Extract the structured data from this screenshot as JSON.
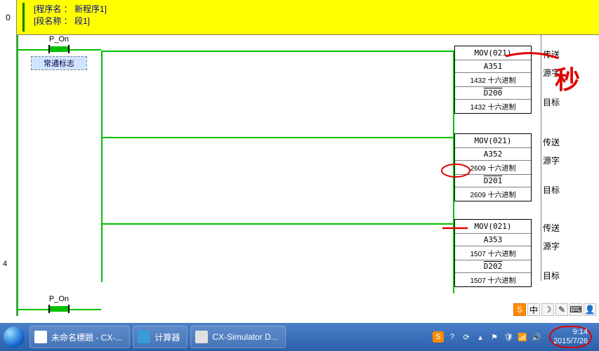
{
  "header": {
    "rung_index": "0",
    "line1": "[程序名 ： 新程序1]",
    "line2": "[段名称 ： 段1]"
  },
  "contact": {
    "label": "P_On",
    "comment": "常通标志"
  },
  "contact2": {
    "label": "P_On"
  },
  "blocks": [
    {
      "title": "MOV(021)",
      "src": "A351",
      "src_val": "1432 十六进制",
      "dst": "D200",
      "dst_val": "1432 十六进制",
      "lab1": "传送",
      "lab2": "源字",
      "lab3": "目标"
    },
    {
      "title": "MOV(021)",
      "src": "A352",
      "src_val": "2609 十六进制",
      "dst": "D201",
      "dst_val": "2609 十六进制",
      "lab1": "传送",
      "lab2": "源字",
      "lab3": "目标"
    },
    {
      "title": "MOV(021)",
      "src": "A353",
      "src_val": "1507 十六进制",
      "dst": "D202",
      "dst_val": "1507 十六进制",
      "lab1": "传送",
      "lab2": "源字",
      "lab3": "目标"
    }
  ],
  "rung_index_bottom": "4",
  "annotation_text": "秒",
  "tray": {
    "s": "S",
    "zhong": "中",
    "moon": "☽",
    "gear": "✎",
    "kbd": "⌨",
    "user": "👤"
  },
  "taskbar": {
    "apps": [
      {
        "label": "未命名標題 - CX-..."
      },
      {
        "label": "计算器"
      },
      {
        "label": "CX-Simulator D..."
      }
    ],
    "clock_time": "9:14",
    "clock_date": "2015/7/26"
  }
}
